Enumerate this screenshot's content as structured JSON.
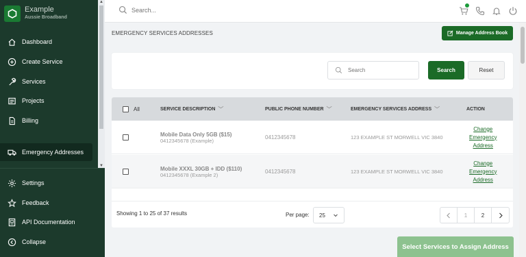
{
  "brand": {
    "name": "Example",
    "subtitle": "Aussie Broadband"
  },
  "sidebar": {
    "items": [
      {
        "label": "Dashboard",
        "icon": "home-icon"
      },
      {
        "label": "Create Service",
        "icon": "plus-circle-icon"
      },
      {
        "label": "Services",
        "icon": "wrench-icon"
      },
      {
        "label": "Projects",
        "icon": "projects-icon"
      },
      {
        "label": "Billing",
        "icon": "document-icon"
      },
      {
        "label": "Emergency Addresses",
        "icon": "truck-icon",
        "active": true
      }
    ],
    "bottom_items": [
      {
        "label": "Settings",
        "icon": "gear-icon"
      },
      {
        "label": "Feedback",
        "icon": "star-icon"
      },
      {
        "label": "API Documentation",
        "icon": "api-doc-icon"
      },
      {
        "label": "Collapse",
        "icon": "collapse-icon"
      }
    ]
  },
  "topbar": {
    "search_placeholder": "Search...",
    "icons": [
      "cart-icon",
      "phone-icon",
      "bell-icon",
      "power-icon"
    ]
  },
  "header": {
    "title": "EMERGENCY SERVICES ADDRESSES",
    "manage_button": "Manage Address Book"
  },
  "filter": {
    "search_placeholder": "Search",
    "search_button": "Search",
    "reset_button": "Reset"
  },
  "table": {
    "headers": {
      "all": "All",
      "service": "SERVICE DESCRIPTION",
      "phone": "PUBLIC PHONE NUMBER",
      "address": "EMERGENCY SERVICES ADDRESS",
      "action": "ACTION"
    },
    "rows": [
      {
        "name": "Mobile Data Only 5GB ($15)",
        "sub": "0412345678 (Example)",
        "phone": "0412345678",
        "address": "123 EXAMPLE ST MORWELL VIC 3840",
        "action": [
          "Change",
          "Emergency",
          "Address"
        ]
      },
      {
        "name": "Mobile XXXL 30GB + IDD ($110)",
        "sub": "0412345678 (Example 2)",
        "phone": "0412345678",
        "address": "123 EXAMPLE ST MORWELL VIC 3840",
        "action": [
          "Change",
          "Emergency",
          "Address"
        ]
      }
    ]
  },
  "pagination": {
    "showing": "Showing 1 to 25 of 37 results",
    "per_page_label": "Per page:",
    "per_page_value": "25",
    "pages": [
      "1",
      "2"
    ],
    "current_page": "2"
  },
  "assign_button": "Select Services to Assign Address",
  "colors": {
    "sidebar": "#1c3a2c",
    "primary": "#1b6b27",
    "assign_disabled": "#8dc28f"
  }
}
